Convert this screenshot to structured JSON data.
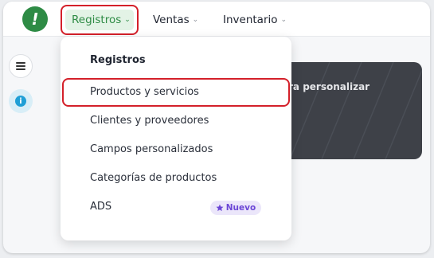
{
  "nav": {
    "logo_glyph": "!",
    "items": [
      {
        "label": "Registros"
      },
      {
        "label": "Ventas"
      },
      {
        "label": "Inventario"
      }
    ],
    "chevron": "⌄"
  },
  "dropdown": {
    "header": "Registros",
    "items": [
      {
        "label": "Productos y servicios"
      },
      {
        "label": "Clientes y proveedores"
      },
      {
        "label": "Campos personalizados"
      },
      {
        "label": "Categorías de productos"
      },
      {
        "label": "ADS"
      }
    ],
    "badge": {
      "label": "Nuevo",
      "icon": "star-icon"
    }
  },
  "banner": {
    "line1": "ra personalizar",
    "line2": "."
  },
  "colors": {
    "brand": "#2e8b45",
    "highlight": "#d4202a",
    "badge": "#6b46d6"
  }
}
